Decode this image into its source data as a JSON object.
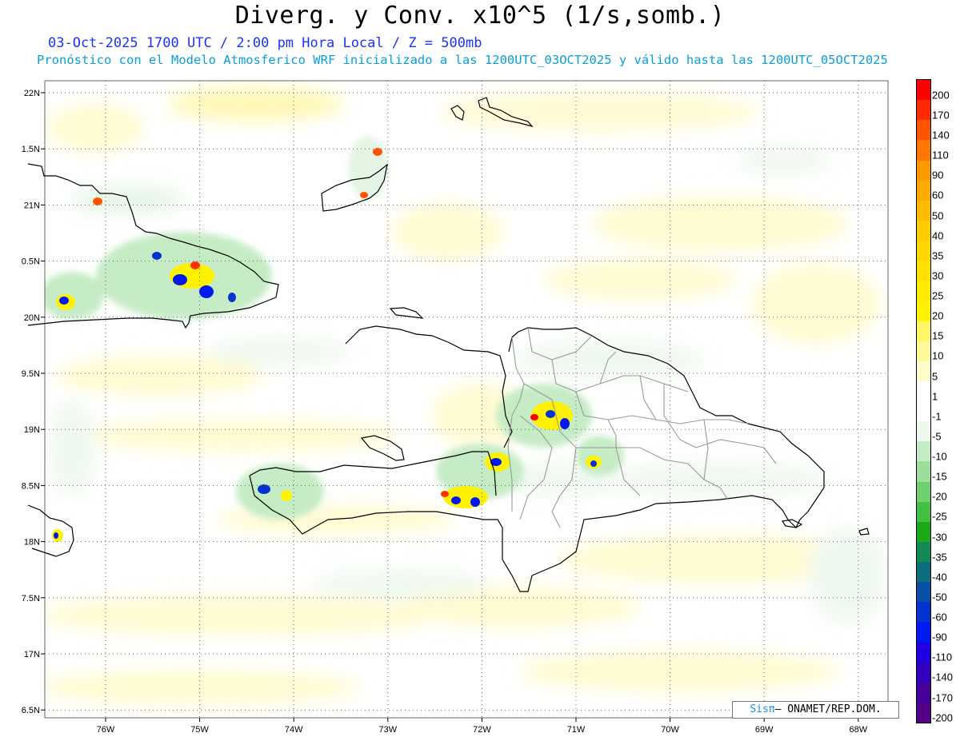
{
  "header": {
    "title": "Diverg. y Conv. x10^5 (1/s,somb.)",
    "subtitle": "03-Oct-2025  1700 UTC / 2:00 pm Hora Local / Z = 500mb",
    "subtitle2": "Pronóstico con el Modelo Atmosferico WRF inicializado a las 1200UTC_03OCT2025 y válido hasta las  1200UTC_05OCT2025"
  },
  "axes": {
    "lat_labels": [
      "22N",
      "1.5N",
      "21N",
      "0.5N",
      "20N",
      "9.5N",
      "19N",
      "8.5N",
      "18N",
      "7.5N",
      "17N",
      "6.5N"
    ],
    "lon_labels": [
      "76W",
      "75W",
      "74W",
      "73W",
      "72W",
      "71W",
      "70W",
      "69W",
      "68W"
    ]
  },
  "colorbar": {
    "labels": [
      "200",
      "170",
      "140",
      "110",
      "90",
      "60",
      "50",
      "40",
      "35",
      "30",
      "25",
      "20",
      "15",
      "10",
      "5",
      "1",
      "-1",
      "-5",
      "-10",
      "-15",
      "-20",
      "-25",
      "-30",
      "-35",
      "-40",
      "-50",
      "-60",
      "-90",
      "-110",
      "-140",
      "-170",
      "-200"
    ],
    "colors": [
      "#ff0000",
      "#ff2a00",
      "#ff5500",
      "#ff7700",
      "#ff9900",
      "#ffaa00",
      "#ffbb00",
      "#ffcc00",
      "#ffd700",
      "#ffe100",
      "#ffeb00",
      "#fff200",
      "#fff766",
      "#fffa99",
      "#fffccc",
      "#ffffff",
      "#ffffff",
      "#eef8ee",
      "#c6ecc6",
      "#9bdd9b",
      "#6fcf6f",
      "#44bf44",
      "#19a919",
      "#138a55",
      "#0e6e7d",
      "#0a4fa6",
      "#0533d0",
      "#0019f0",
      "#2200dd",
      "#3300bb",
      "#440099",
      "#550088"
    ]
  },
  "credit": {
    "sis": "Sisπ",
    "org": "– ONAMET/REP.DOM."
  }
}
